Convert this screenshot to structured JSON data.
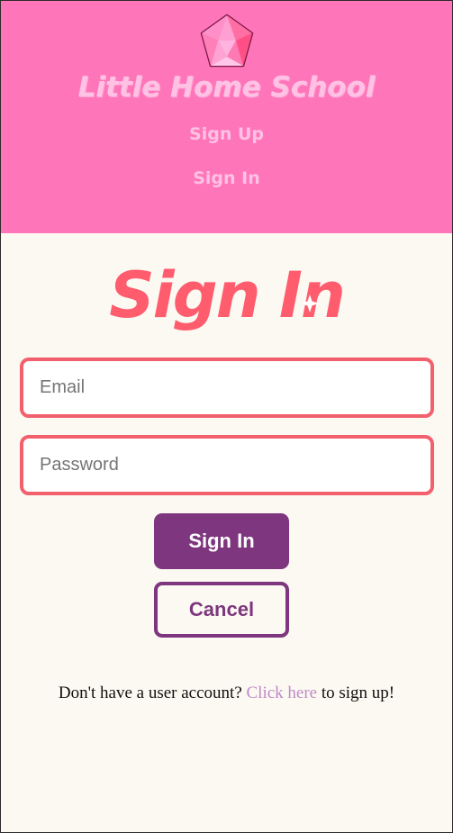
{
  "header": {
    "brand": "Little Home School",
    "logo_icon": "gem-icon",
    "nav": [
      {
        "label": "Sign Up"
      },
      {
        "label": "Sign In"
      }
    ]
  },
  "main": {
    "title": "Sign In",
    "email": {
      "placeholder": "Email",
      "value": ""
    },
    "password": {
      "placeholder": "Password",
      "value": ""
    },
    "signin_button": "Sign In",
    "cancel_button": "Cancel",
    "footer": {
      "prefix": "Don't have a user account? ",
      "link": "Click here",
      "suffix": " to sign up!"
    }
  },
  "colors": {
    "header_bg": "#FF75BA",
    "page_bg": "#FBF9F1",
    "accent_red": "#FF5C6E",
    "button_purple": "#7E367E",
    "link_purple": "#C08AC9"
  }
}
